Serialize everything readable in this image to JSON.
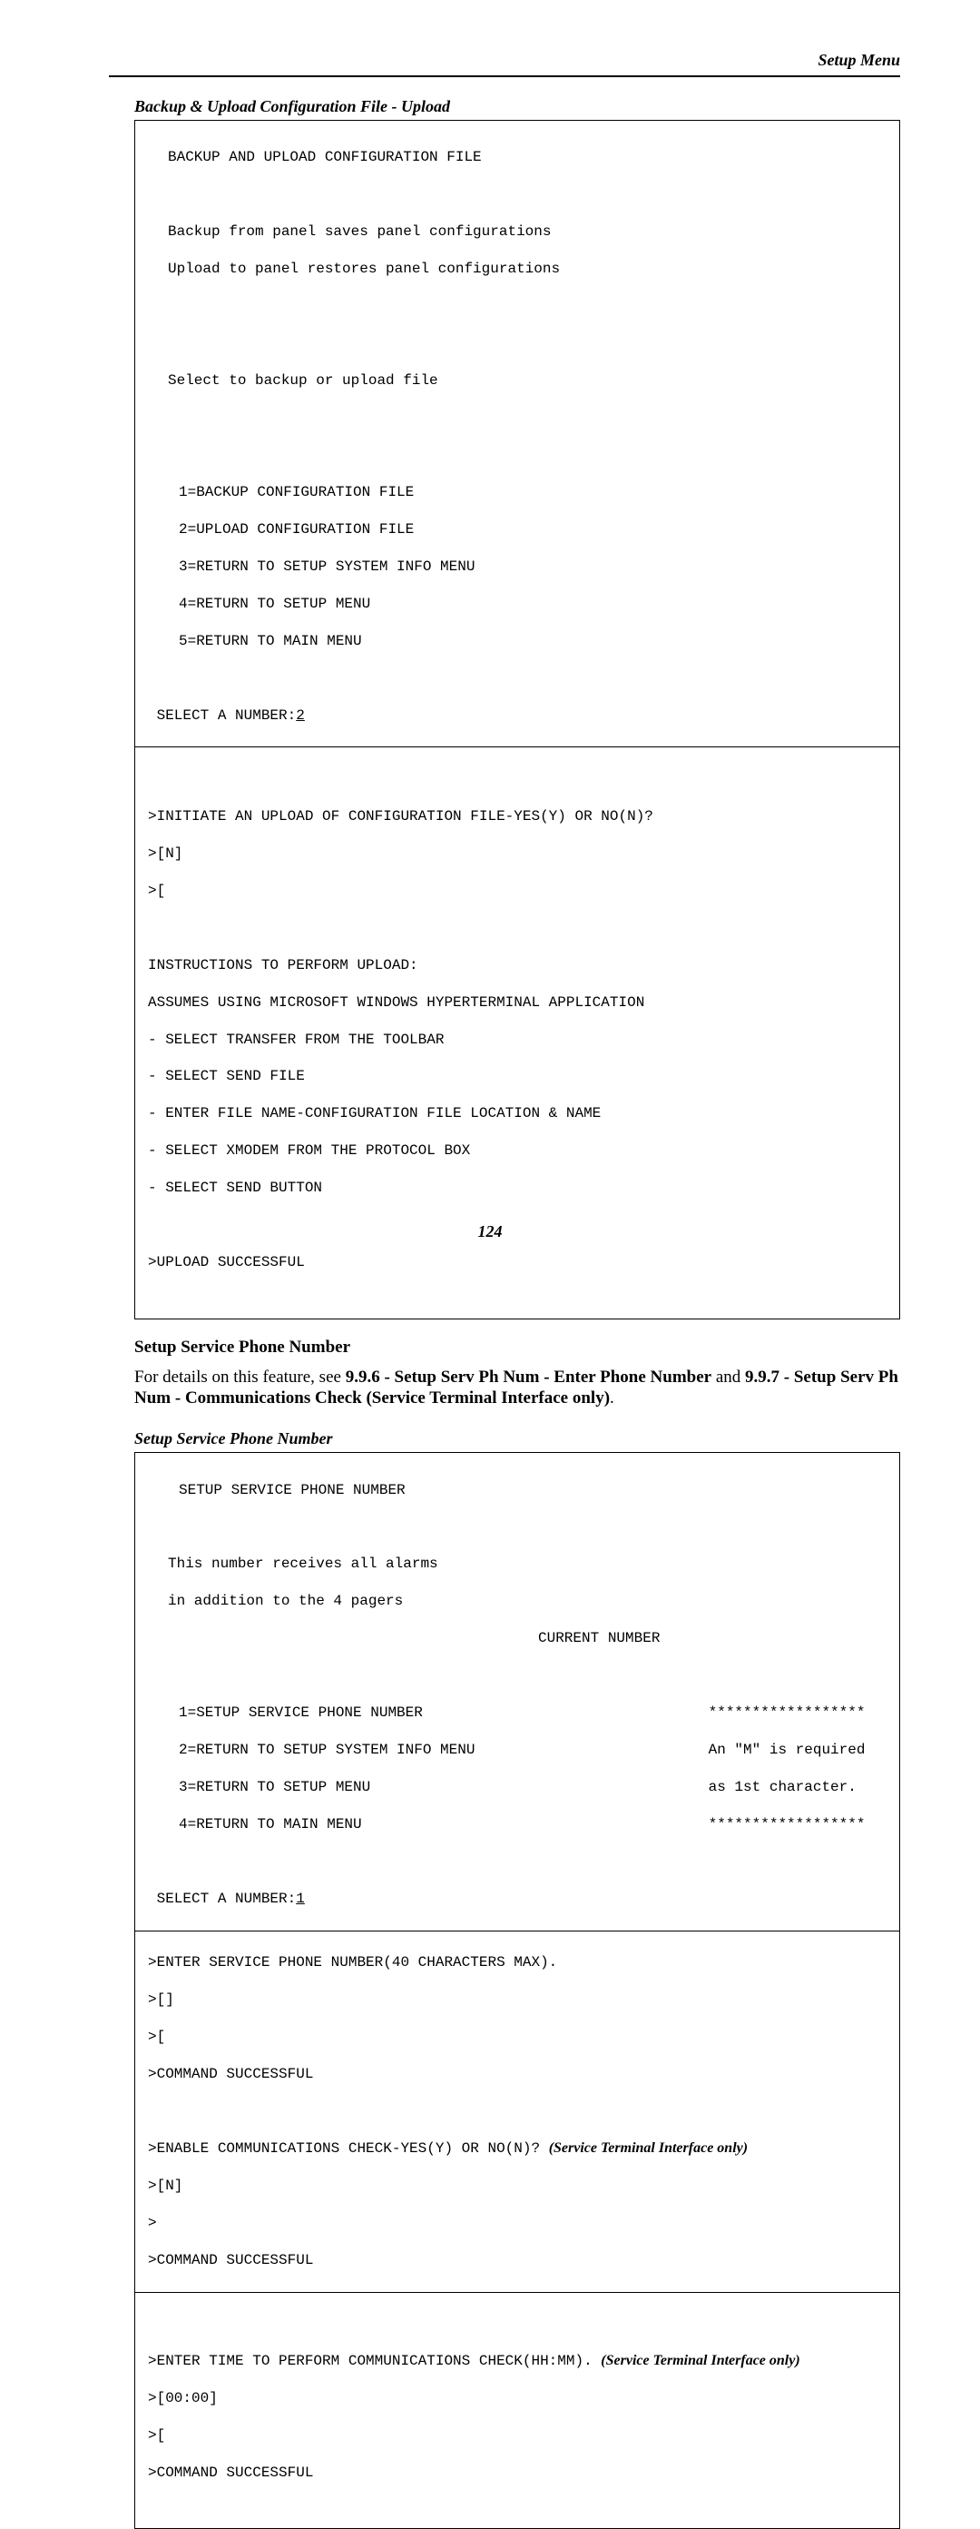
{
  "header": {
    "right_title": "Setup Menu"
  },
  "caption1": "Backup & Upload Configuration File - Upload",
  "box1": {
    "title": "BACKUP AND UPLOAD CONFIGURATION FILE",
    "desc1": "Backup from panel saves panel configurations",
    "desc2": "Upload to panel restores panel configurations",
    "prompt_select": "Select to backup or upload file",
    "opt1": "1=BACKUP CONFIGURATION FILE",
    "opt2": "2=UPLOAD CONFIGURATION FILE",
    "opt3": "3=RETURN TO SETUP SYSTEM INFO MENU",
    "opt4": "4=RETURN TO SETUP MENU",
    "opt5": "5=RETURN TO MAIN MENU",
    "select_label": " SELECT A NUMBER:",
    "select_value": "2",
    "line1": ">INITIATE AN UPLOAD OF CONFIGURATION FILE-YES(Y) OR NO(N)?",
    "line2": ">[N]",
    "line3": ">[",
    "instr_head": "INSTRUCTIONS TO PERFORM UPLOAD:",
    "instr1": "ASSUMES USING MICROSOFT WINDOWS HYPERTERMINAL APPLICATION",
    "instr2": "- SELECT TRANSFER FROM THE TOOLBAR",
    "instr3": "- SELECT SEND FILE",
    "instr4": "- ENTER FILE NAME-CONFIGURATION FILE LOCATION & NAME",
    "instr5": "- SELECT XMODEM FROM THE PROTOCOL BOX",
    "instr6": "- SELECT SEND BUTTON",
    "result": ">UPLOAD SUCCESSFUL"
  },
  "sub1": "Setup Service Phone Number",
  "body1_pre": "For details on this feature, see ",
  "body1_b1": "9.9.6 - Setup Serv Ph Num - Enter Phone Number",
  "body1_mid": " and ",
  "body1_b2": "9.9.7 - Setup Serv Ph Num - Communications Check (Service Terminal Interface only)",
  "body1_post": ".",
  "caption2": "Setup Service Phone Number",
  "box2": {
    "title": "SETUP SERVICE PHONE NUMBER",
    "desc1": "This number receives all alarms",
    "desc2": "in addition to the 4 pagers",
    "current_label": "CURRENT NUMBER",
    "opt1": "1=SETUP SERVICE PHONE NUMBER",
    "opt1r": "******************",
    "opt2": "2=RETURN TO SETUP SYSTEM INFO MENU",
    "opt2r": "An \"M\" is required",
    "opt3": "3=RETURN TO SETUP MENU",
    "opt3r": "as 1st character.",
    "opt4": "4=RETURN TO MAIN MENU",
    "opt4r": "******************",
    "select_label": " SELECT A NUMBER:",
    "select_value": "1",
    "line1": ">ENTER SERVICE PHONE NUMBER(40 CHARACTERS MAX).",
    "line2": ">[]",
    "line3": ">[",
    "line4": ">COMMAND SUCCESSFUL",
    "line5a": ">ENABLE COMMUNICATIONS CHECK-YES(Y) OR NO(N)?",
    "note1": "(Service Terminal Interface only)",
    "line6": ">[N]",
    "line7": ">",
    "line8": ">COMMAND SUCCESSFUL",
    "line9a": ">ENTER TIME TO PERFORM COMMUNICATIONS CHECK(HH:MM).",
    "note2": "(Service Terminal Interface only)",
    "line10": ">[00:00]",
    "line11": ">[",
    "line12": ">COMMAND SUCCESSFUL"
  },
  "page_number": "124"
}
